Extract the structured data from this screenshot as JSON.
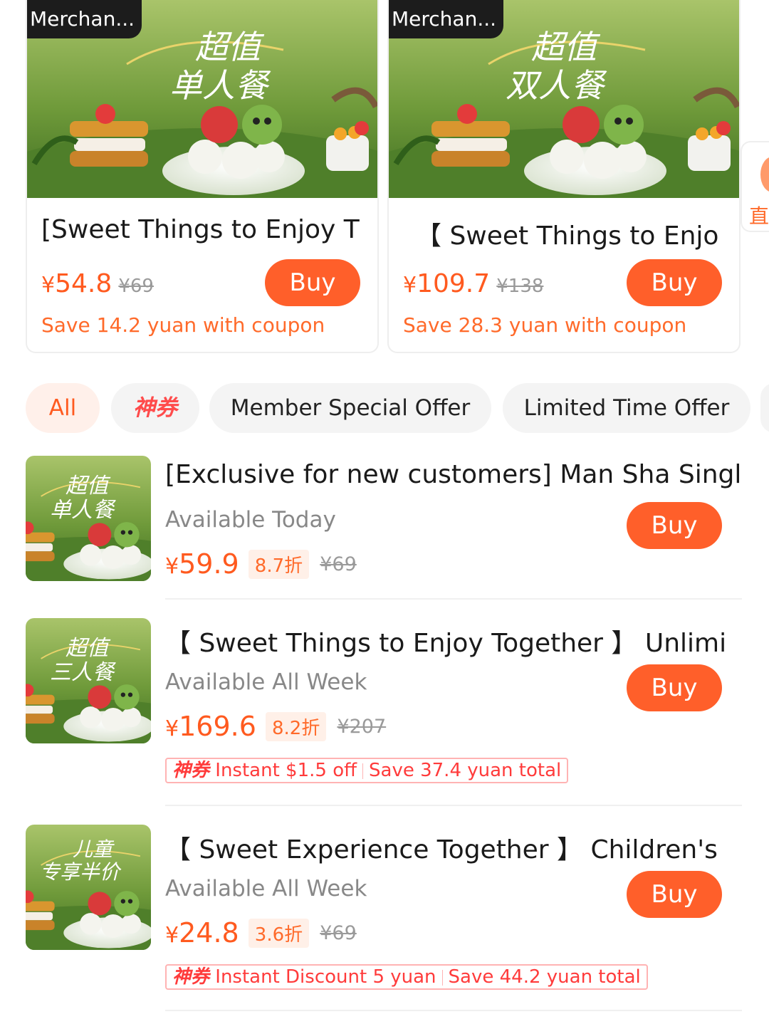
{
  "featured": [
    {
      "merchant_tag": "Merchan...",
      "art_lines": [
        "超值",
        "单人餐"
      ],
      "title": "[Sweet Things to Enjoy T",
      "currency": "¥",
      "price": "54.8",
      "original": "¥69",
      "buy_label": "Buy",
      "coupon_text": "Save 14.2 yuan with coupon"
    },
    {
      "merchant_tag": "Merchan...",
      "art_lines": [
        "超值",
        "双人餐"
      ],
      "title": "【 Sweet Things to Enjo",
      "currency": "¥",
      "price": "109.7",
      "original": "¥138",
      "buy_label": "Buy",
      "coupon_text": "Save 28.3 yuan with coupon"
    }
  ],
  "side_peek_text": "直",
  "filters": [
    "All",
    "神券",
    "Member Special Offer",
    "Limited Time Offer"
  ],
  "items": [
    {
      "art_lines": [
        "超值",
        "单人餐"
      ],
      "title": "[Exclusive for new customers] Man Sha Singl",
      "availability": "Available Today",
      "currency": "¥",
      "price": "59.9",
      "discount": "8.7折",
      "original": "¥69",
      "buy_label": "Buy"
    },
    {
      "art_lines": [
        "超值",
        "三人餐"
      ],
      "title": "【 Sweet Things to Enjoy Together 】 Unlimi",
      "availability": "Available All Week",
      "currency": "¥",
      "price": "169.6",
      "discount": "8.2折",
      "original": "¥207",
      "buy_label": "Buy",
      "coupon_badge": "神券",
      "coupon_offer": "Instant $1.5 off",
      "coupon_total": "Save 37.4 yuan total"
    },
    {
      "art_lines": [
        "儿童",
        "专享半价"
      ],
      "title": "【 Sweet Experience Together 】 Children's",
      "availability": "Available All Week",
      "currency": "¥",
      "price": "24.8",
      "discount": "3.6折",
      "original": "¥69",
      "buy_label": "Buy",
      "coupon_badge": "神券",
      "coupon_offer": "Instant Discount 5 yuan",
      "coupon_total": "Save 44.2 yuan total"
    }
  ],
  "colors": {
    "accent": "#ff5f2a",
    "price": "#ff5a1f",
    "coupon_red": "#ff3b3b",
    "chip_bg": "#f4f4f4",
    "active_chip_bg": "#fff0ea"
  }
}
